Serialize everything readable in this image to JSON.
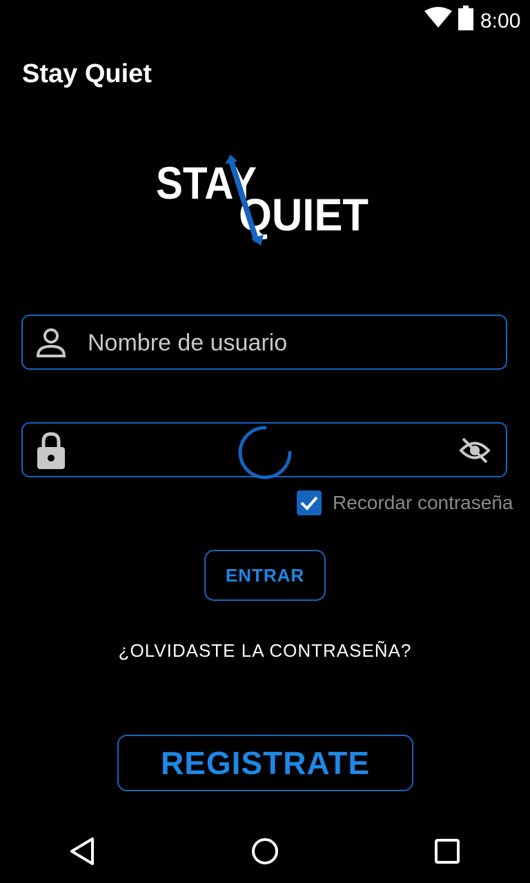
{
  "status_bar": {
    "time": "8:00",
    "icons": [
      "wifi-icon",
      "battery-icon"
    ]
  },
  "app_bar": {
    "title": "Stay Quiet"
  },
  "logo": {
    "line1": "STAY",
    "line2": "QUIET"
  },
  "username_field": {
    "placeholder": "Nombre de usuario",
    "value": "",
    "icon": "person-icon"
  },
  "password_field": {
    "placeholder": "",
    "value": "",
    "icon": "lock-icon",
    "toggle_icon": "visibility-off-icon"
  },
  "loading": {
    "icon": "progress-spinner"
  },
  "remember": {
    "label": "Recordar contraseña",
    "checked": true
  },
  "buttons": {
    "enter": "ENTRAR",
    "forgot": "¿OLVIDASTE LA CONTRASEÑA?",
    "register": "REGISTRATE"
  },
  "colors": {
    "accent": "#1565c0",
    "accent_text": "#1e88e5",
    "background": "#000000"
  },
  "nav_bar": {
    "icons": [
      "back-icon",
      "home-icon",
      "recents-icon"
    ]
  }
}
